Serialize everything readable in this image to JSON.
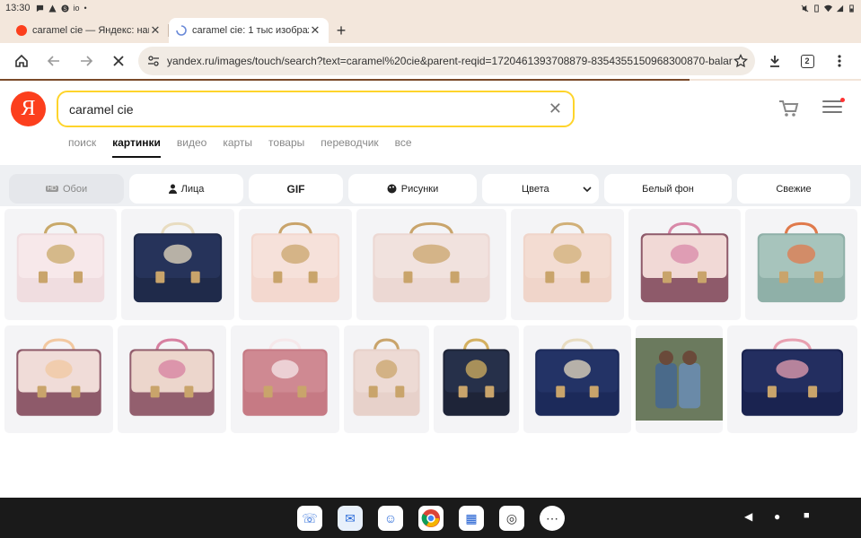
{
  "status_bar": {
    "time": "13:30",
    "left_icons": [
      "chat-icon",
      "warning-icon",
      "s-icon",
      "io-text",
      "dot"
    ],
    "io_label": "io",
    "right_icons": [
      "mute-icon",
      "vibrate-icon",
      "wifi-icon",
      "signal-icon",
      "battery-icon"
    ]
  },
  "tabs": [
    {
      "title": "caramel cie — Яндекс: наш",
      "favicon": "yandex-favicon",
      "active": false
    },
    {
      "title": "caramel cie: 1 тыс изображ",
      "favicon": "loading-favicon",
      "active": true
    }
  ],
  "toolbar": {
    "url": "yandex.ru/images/touch/search?text=caramel%20cie&parent-reqid=1720461393708879-8354355150968300870-balar",
    "tab_count": "2"
  },
  "yandex": {
    "logo_letter": "Я",
    "query": "caramel cie",
    "nav": [
      {
        "label": "поиск",
        "active": false
      },
      {
        "label": "картинки",
        "active": true
      },
      {
        "label": "видео",
        "active": false
      },
      {
        "label": "карты",
        "active": false
      },
      {
        "label": "товары",
        "active": false
      },
      {
        "label": "переводчик",
        "active": false
      },
      {
        "label": "все",
        "active": false
      }
    ]
  },
  "filters": [
    {
      "label": "Обои",
      "prefix": "HD",
      "dim": true
    },
    {
      "label": "Лица",
      "icon": "person-icon"
    },
    {
      "label": "GIF",
      "bold": true
    },
    {
      "label": "Рисунки",
      "icon": "palette-icon"
    },
    {
      "label": "Цвета",
      "dropdown": true
    },
    {
      "label": "Белый фон"
    },
    {
      "label": "Свежие"
    }
  ],
  "images": [
    {
      "name": "pink-unicorn-satchel",
      "color": "#f0dde0",
      "flap": "#f7e8ea",
      "accent": "#c9a96a"
    },
    {
      "name": "navy-butterfly-satchel",
      "color": "#1f2a4a",
      "flap": "#26335a",
      "accent": "#e8dcc0"
    },
    {
      "name": "pink-dragonfly-satchel",
      "color": "#f3d8cf",
      "flap": "#f6e1da",
      "accent": "#c9a46b"
    },
    {
      "name": "pink-winged-satchel",
      "color": "#ecd8d3",
      "flap": "#f1e2de",
      "accent": "#c9a46b"
    },
    {
      "name": "pink-glitter-dragonfly-satchel",
      "color": "#f0d5ca",
      "flap": "#f3dcd2",
      "accent": "#d1b078"
    },
    {
      "name": "plum-floral-satchel",
      "color": "#8e5a6a",
      "flap": "#f1d9d6",
      "accent": "#d888a8"
    },
    {
      "name": "mint-fox-satchel",
      "color": "#8fb0a8",
      "flap": "#a7c4bc",
      "accent": "#e07a4c"
    },
    {
      "name": "plum-rainbow-satchel",
      "color": "#8e5a6a",
      "flap": "#f0dcd8",
      "accent": "#f2c8a0"
    },
    {
      "name": "plum-wildflower-satchel",
      "color": "#935f6e",
      "flap": "#ecd6cc",
      "accent": "#d77fa0"
    },
    {
      "name": "rose-horse-satchel",
      "color": "#c67a84",
      "flap": "#cf8992",
      "accent": "#f6e8ea"
    },
    {
      "name": "small-pink-satchel",
      "color": "#e7d1ca",
      "flap": "#eddad4",
      "accent": "#c9a46b"
    },
    {
      "name": "navy-gold-wing-satchel",
      "color": "#1e2438",
      "flap": "#26304a",
      "accent": "#d4b060"
    },
    {
      "name": "navy-unicorn-satchel",
      "color": "#1c2a5a",
      "flap": "#233366",
      "accent": "#e8dcc0"
    },
    {
      "name": "kids-backpack-photo",
      "color": "#6b7a5e",
      "flap": "#4a6a8a",
      "accent": "#c9d6e0"
    },
    {
      "name": "navy-bunny-satchel",
      "color": "#1a2350",
      "flap": "#232e60",
      "accent": "#e8a0b0"
    }
  ],
  "dock": [
    {
      "name": "phone-app",
      "color": "#ffffff",
      "glyph": "☏"
    },
    {
      "name": "messages-app",
      "color": "#ffffff",
      "glyph": "✉"
    },
    {
      "name": "contacts-app",
      "color": "#ffffff",
      "glyph": "☺"
    },
    {
      "name": "chrome-app",
      "color": "#ffffff",
      "glyph": "◉"
    },
    {
      "name": "files-app",
      "color": "#ffffff",
      "glyph": "▦"
    },
    {
      "name": "camera-app",
      "color": "#ffffff",
      "glyph": "◎"
    },
    {
      "name": "all-apps",
      "color": "#ffffff",
      "glyph": "⋯"
    }
  ],
  "android_nav": {
    "back": "◀",
    "home": "●",
    "recents": "■"
  }
}
